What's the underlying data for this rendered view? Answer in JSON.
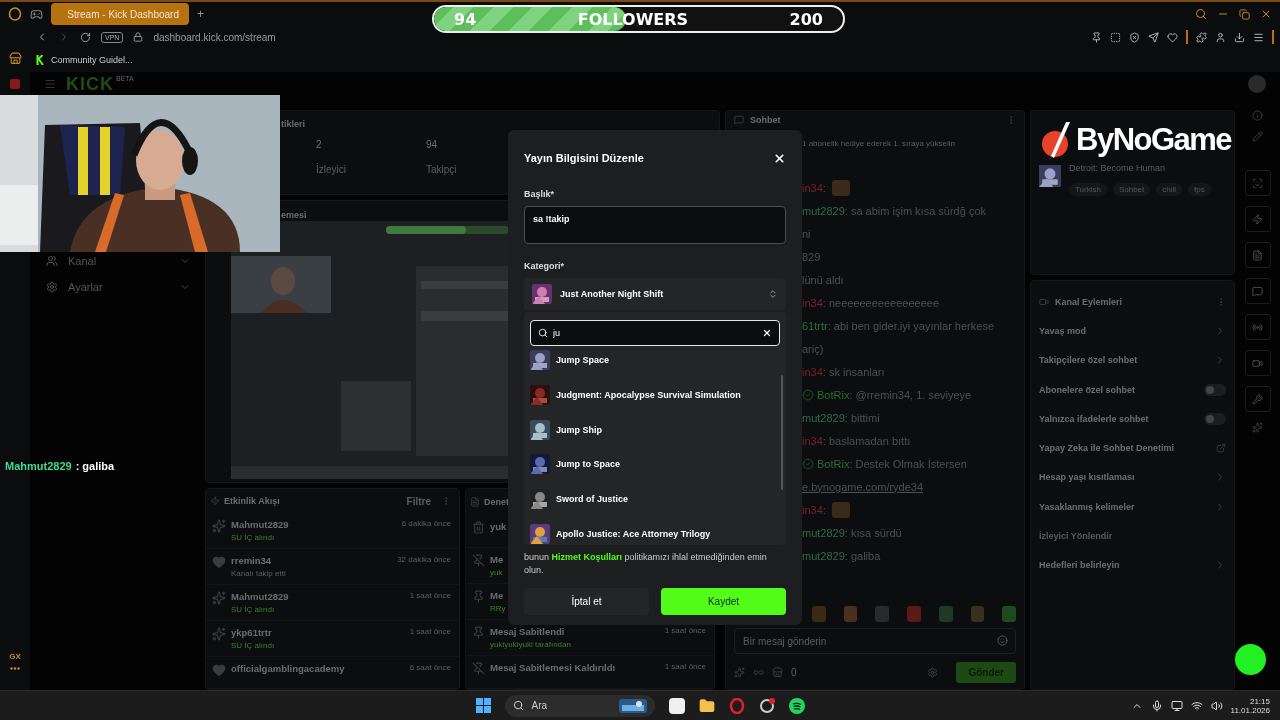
{
  "browser": {
    "tab_title": "Stream - Kick Dashboard",
    "new_tab": "+",
    "vpn": "VPN",
    "url": "dashboard.kick.com/stream",
    "bookmark": "Community Guidel...",
    "sidebar_badge": "GX"
  },
  "followers_bar": {
    "current": "94",
    "label": "FOLLOWERS",
    "goal": "200",
    "level": 0.47
  },
  "kick_header": {
    "logo": "KICK",
    "beta": "BETA"
  },
  "nav": [
    {
      "label": "Kanal",
      "kind": "channel"
    },
    {
      "label": "Ayarlar",
      "kind": "settings"
    }
  ],
  "stats": {
    "title": "tikleri",
    "items": [
      {
        "value": "2",
        "label": "İzleyici"
      },
      {
        "value": "94",
        "label": "Takipçi"
      }
    ]
  },
  "preview": {
    "title": "emesi"
  },
  "activity": {
    "title": "Etkinlik Akışı",
    "filter": "Filtre",
    "items": [
      {
        "kind": "gift",
        "user": "Mahmut2829",
        "detail": "SU İÇ alındı",
        "time": "6 dakika önce"
      },
      {
        "kind": "follow",
        "user": "rremin34",
        "detail": "Kanalı takip etti",
        "time": "32 dakika önce"
      },
      {
        "kind": "gift",
        "user": "Mahmut2829",
        "detail": "SU İÇ alındı",
        "time": "1 saat önce"
      },
      {
        "kind": "gift",
        "user": "ykp61trtr",
        "detail": "SU İÇ alındı",
        "time": "1 saat önce"
      },
      {
        "kind": "follow",
        "user": "officialgamblingacademy",
        "time": "6 saat önce"
      }
    ]
  },
  "moderation": {
    "title": "Denet",
    "items": [
      {
        "kind": "delete",
        "title": "yuk"
      },
      {
        "kind": "unpin",
        "title": "Me",
        "detail": "yuk"
      },
      {
        "kind": "pin",
        "title": "Me",
        "detail": "RRy"
      },
      {
        "kind": "pin",
        "title": "Mesaj Sabitlendi",
        "detail": "yukiyukiyuki tarafından",
        "time": "1 saat önce"
      },
      {
        "kind": "unpin",
        "title": "Mesaj Sabitlemesi Kaldırıldı",
        "time": "1 saat önce"
      }
    ]
  },
  "chat": {
    "title": "Sohbet",
    "hint": "1 abonelik hediye ederek 1. sıraya yükselin",
    "messages": [
      {
        "kind": "message",
        "user": "in34",
        "color": "#7a1f2b",
        "text": ":",
        "emote": true
      },
      {
        "kind": "message",
        "user": "mut2829",
        "color": "#2b6e45",
        "text": ": sa abim işim kısa sürdğ çok"
      },
      {
        "kind": "continuation",
        "text": "ni"
      },
      {
        "kind": "continuation",
        "text": "829"
      },
      {
        "kind": "continuation",
        "text": "lünü aldı"
      },
      {
        "kind": "message",
        "user": "in34",
        "color": "#7a1f2b",
        "text": ": neeeeeeeeeeeeeeeee"
      },
      {
        "kind": "message",
        "user": "61trtr",
        "color": "#2b6e45",
        "text": ": abi ben gider.iyi yayınlar herkese"
      },
      {
        "kind": "continuation",
        "text": "ariç)"
      },
      {
        "kind": "message",
        "user": "in34",
        "color": "#7a1f2b",
        "text": ": sk insanları"
      },
      {
        "kind": "bot",
        "user": "BotRix",
        "color": "#2f6b2f",
        "text": ": @rremin34, 1. seviyeye"
      },
      {
        "kind": "message",
        "user": "mut2829",
        "color": "#2b6e45",
        "text": ": bittimi"
      },
      {
        "kind": "message",
        "user": "in34",
        "color": "#7a1f2b",
        "text": ": baslamadan bıttı"
      },
      {
        "kind": "bot",
        "user": "BotRix",
        "color": "#2f6b2f",
        "text": ": Destek Olmak İstersen"
      },
      {
        "kind": "link",
        "text": "e.bynogame.com/ryde34"
      },
      {
        "kind": "message",
        "user": "in34",
        "color": "#7a1f2b",
        "text": ":",
        "emote": true
      },
      {
        "kind": "message",
        "user": "mut2829",
        "color": "#2b6e45",
        "text": ": kısa sürdü"
      },
      {
        "kind": "message",
        "user": "mut2829",
        "color": "#2b6e45",
        "text": ": galiba"
      }
    ],
    "placeholder": "Bir mesaj gönderin",
    "count": "0",
    "send": "Gönder"
  },
  "stream_info": {
    "category": "Detroit: Become Human",
    "tags": [
      "Turkish",
      "Sohbet",
      "chill",
      "fps"
    ]
  },
  "channel_actions": {
    "title": "Kanal Eylemleri",
    "items": [
      {
        "kind": "chevron",
        "label": "Yavaş mod"
      },
      {
        "kind": "chevron",
        "label": "Takipçilere özel sohbet"
      },
      {
        "kind": "toggle",
        "label": "Abonelere özel sohbet",
        "on": false
      },
      {
        "kind": "toggle",
        "label": "Yalnızca ifadelerle sohbet",
        "on": false
      },
      {
        "kind": "external",
        "label": "Yapay Zeka ile Sohbet Denetimi"
      },
      {
        "kind": "chevron",
        "label": "Hesap yaşı kısıtlaması"
      },
      {
        "kind": "chevron",
        "label": "Yasaklanmış kelimeler"
      },
      {
        "kind": "section",
        "label": "İzleyici Yönlendir"
      },
      {
        "kind": "chevron",
        "label": "Hedefleri belirleyin"
      }
    ]
  },
  "overlay_logo": {
    "text": "ByNoGame"
  },
  "overlay_chat": {
    "user": "Mahmut2829",
    "text": ": galiba"
  },
  "modal": {
    "title": "Yayın Bilgisini Düzenle",
    "title_label": "Başlık*",
    "title_value": "sa !takip",
    "category_label": "Kategori*",
    "category_value": "Just Another Night Shift",
    "search_value": "ju",
    "results": [
      "Jump Space",
      "Judgment: Apocalypse Survival Simulation",
      "Jump Ship",
      "Jump to Space",
      "Sword of Justice",
      "Apollo Justice: Ace Attorney Trilogy"
    ],
    "notice_before": "bunun",
    "notice_link": "Hizmet Koşulları",
    "notice_after": "politikamızı ihlal etmediğinden emin olun.",
    "cancel": "İptal et",
    "save": "Kaydet"
  },
  "taskbar": {
    "search": "Ara",
    "time": "21:15",
    "date": "11.01.2026"
  }
}
